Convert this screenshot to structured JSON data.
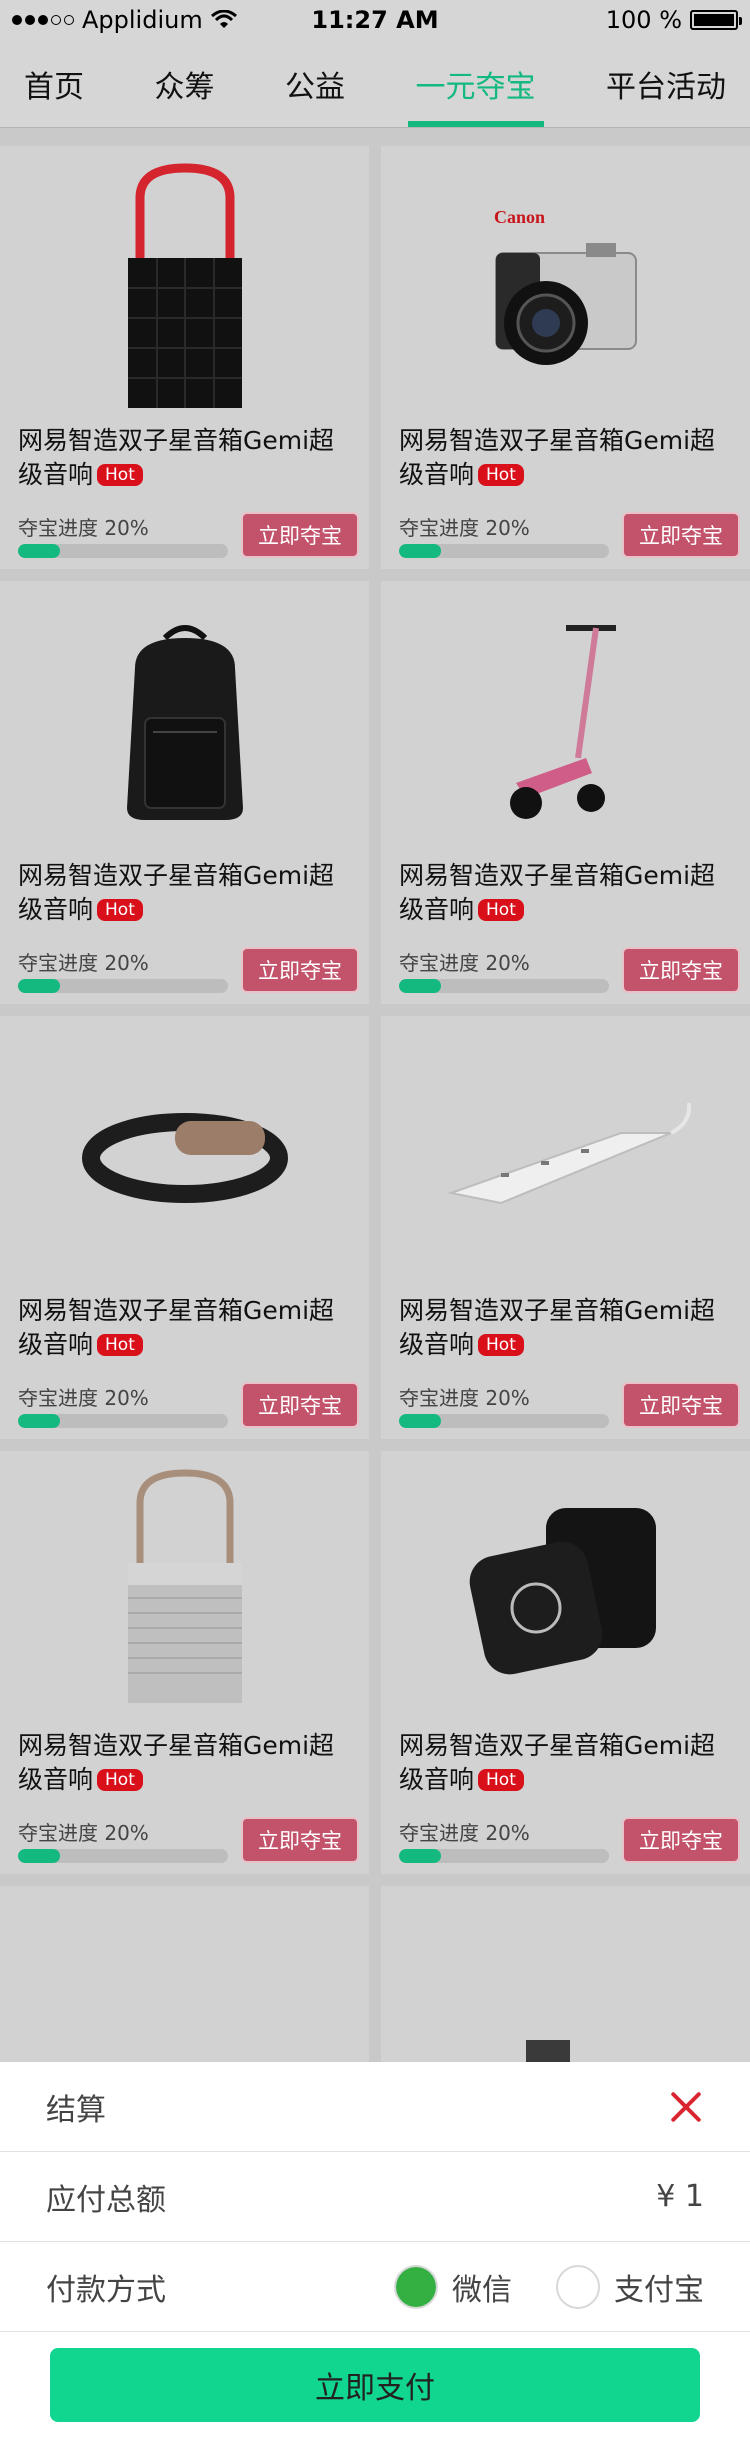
{
  "status_bar": {
    "carrier": "Applidium",
    "time": "11:27 AM",
    "battery_percent": "100 %"
  },
  "tabs": [
    {
      "label": "首页",
      "active": false
    },
    {
      "label": "众筹",
      "active": false
    },
    {
      "label": "公益",
      "active": false
    },
    {
      "label": "一元夺宝",
      "active": true
    },
    {
      "label": "平台活动",
      "active": false
    }
  ],
  "products": [
    {
      "title": "网易智造双子星音箱Gemi超级音响",
      "badge": "Hot",
      "progress_label": "夺宝进度 20%",
      "progress": 0.2,
      "button": "立即夺宝",
      "image": "speaker-black-icon"
    },
    {
      "title": "网易智造双子星音箱Gemi超级音响",
      "badge": "Hot",
      "progress_label": "夺宝进度 20%",
      "progress": 0.2,
      "button": "立即夺宝",
      "image": "camera-icon",
      "brand": "Canon"
    },
    {
      "title": "网易智造双子星音箱Gemi超级音响",
      "badge": "Hot",
      "progress_label": "夺宝进度 20%",
      "progress": 0.2,
      "button": "立即夺宝",
      "image": "backpack-icon"
    },
    {
      "title": "网易智造双子星音箱Gemi超级音响",
      "badge": "Hot",
      "progress_label": "夺宝进度 20%",
      "progress": 0.2,
      "button": "立即夺宝",
      "image": "scooter-icon"
    },
    {
      "title": "网易智造双子星音箱Gemi超级音响",
      "badge": "Hot",
      "progress_label": "夺宝进度 20%",
      "progress": 0.2,
      "button": "立即夺宝",
      "image": "wristband-icon"
    },
    {
      "title": "网易智造双子星音箱Gemi超级音响",
      "badge": "Hot",
      "progress_label": "夺宝进度 20%",
      "progress": 0.2,
      "button": "立即夺宝",
      "image": "power-strip-icon"
    },
    {
      "title": "网易智造双子星音箱Gemi超级音响",
      "badge": "Hot",
      "progress_label": "夺宝进度 20%",
      "progress": 0.2,
      "button": "立即夺宝",
      "image": "speaker-grey-icon"
    },
    {
      "title": "网易智造双子星音箱Gemi超级音响",
      "badge": "Hot",
      "progress_label": "夺宝进度 20%",
      "progress": 0.2,
      "button": "立即夺宝",
      "image": "speaker-cube-icon"
    },
    {
      "title": "",
      "badge": "",
      "progress_label": "",
      "progress": 0,
      "button": "",
      "image": "speaker-pair-icon"
    },
    {
      "title": "",
      "badge": "",
      "progress_label": "",
      "progress": 0,
      "button": "",
      "image": "usb-charger-icon"
    }
  ],
  "checkout": {
    "title": "结算",
    "total_label": "应付总额",
    "total_value": "¥ 1",
    "payment_label": "付款方式",
    "options": [
      {
        "label": "微信",
        "selected": true
      },
      {
        "label": "支付宝",
        "selected": false
      }
    ],
    "pay_button": "立即支付",
    "accent_color": "#10d68f",
    "close_color": "#d9252f"
  }
}
